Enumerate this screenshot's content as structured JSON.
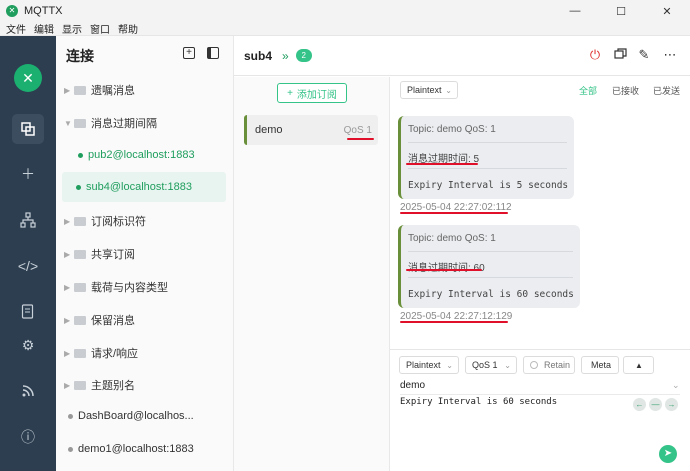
{
  "window": {
    "title": "MQTTX",
    "min": "—",
    "max": "☐",
    "close": "✕"
  },
  "menu": [
    "文件",
    "编辑",
    "显示",
    "窗口",
    "帮助"
  ],
  "connections": {
    "title": "连接",
    "items": [
      {
        "label": "遗嘱消息",
        "type": "folder"
      },
      {
        "label": "消息过期间隔",
        "type": "folder-open"
      },
      {
        "label": "pub2@localhost:1883",
        "type": "conn"
      },
      {
        "label": "sub4@localhost:1883",
        "type": "conn"
      },
      {
        "label": "订阅标识符",
        "type": "folder"
      },
      {
        "label": "共享订阅",
        "type": "folder"
      },
      {
        "label": "载荷与内容类型",
        "type": "folder"
      },
      {
        "label": "保留消息",
        "type": "folder"
      },
      {
        "label": "请求/响应",
        "type": "folder"
      },
      {
        "label": "主题别名",
        "type": "folder"
      },
      {
        "label": "DashBoard@localhos...",
        "type": "conn-gray"
      },
      {
        "label": "demo1@localhost:1883",
        "type": "conn-gray"
      }
    ]
  },
  "header": {
    "name": "sub4",
    "count": "2"
  },
  "subscriptions": {
    "add_label": "添加订阅",
    "items": [
      {
        "topic": "demo",
        "qos": "QoS 1"
      }
    ]
  },
  "messages": {
    "format": "Plaintext",
    "filters": [
      "全部",
      "已接收",
      "已发送"
    ],
    "list": [
      {
        "meta": "Topic: demo   QoS: 1",
        "prop": "消息过期时间: 5",
        "payload": "Expiry Interval is 5 seconds",
        "time": "2025-05-04 22:27:02:112"
      },
      {
        "meta": "Topic: demo   QoS: 1",
        "prop": "消息过期时间: 60",
        "payload": "Expiry Interval is 60 seconds",
        "time": "2025-05-04 22:27:12:129"
      }
    ]
  },
  "publish": {
    "format": "Plaintext",
    "qos": "QoS 1",
    "retain": "Retain",
    "meta": "Meta",
    "topic": "demo",
    "payload": "Expiry Interval is 60 seconds"
  },
  "colors": {
    "accent": "#34c388",
    "nav": "#2c3e50",
    "annotation": "#e0102a"
  }
}
